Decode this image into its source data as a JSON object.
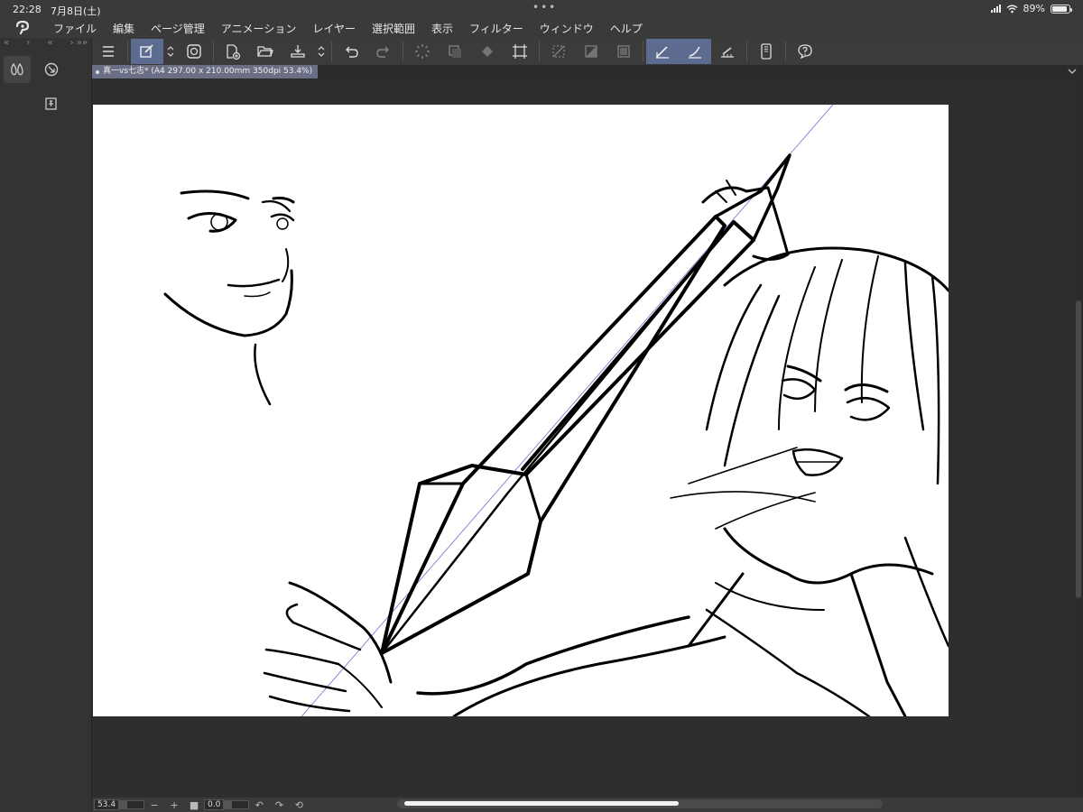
{
  "status": {
    "time": "22:28",
    "date": "7月8日(土)",
    "battery": "89%",
    "battery_level": 0.89
  },
  "menu": [
    "ファイル",
    "編集",
    "ページ管理",
    "アニメーション",
    "レイヤー",
    "選択範囲",
    "表示",
    "フィルター",
    "ウィンドウ",
    "ヘルプ"
  ],
  "document": {
    "tab_title": "真一vs七志* (A4 297.00 x 210.00mm 350dpi 53.4%)"
  },
  "bottom": {
    "zoom": "53.4",
    "rotation": "0.0"
  },
  "colors": {
    "accent": "#5c6b8f",
    "paper": "#ffffff",
    "ruler_line": "#7a6ad0"
  },
  "toolbar_icons": [
    "menu-icon",
    "quick-access-icon",
    "companion-icon",
    "new-file-icon",
    "open-file-icon",
    "save-icon",
    "undo-icon",
    "redo-icon",
    "loading-icon",
    "clear-icon",
    "fill-icon",
    "transform-icon",
    "deselect-icon",
    "invert-selection-icon",
    "show-selection-icon",
    "snap-to-ruler-icon",
    "snap-to-special-ruler-icon",
    "snap-to-grid-icon",
    "smartphone-icon",
    "help-icon"
  ]
}
